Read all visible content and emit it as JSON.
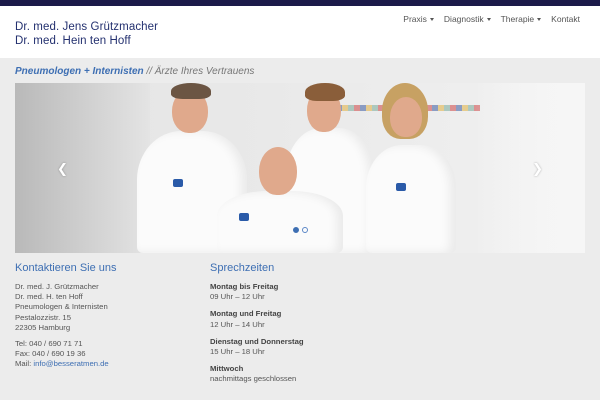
{
  "header": {
    "name1": "Dr. med. Jens Grützmacher",
    "name2": "Dr. med. Hein ten Hoff"
  },
  "nav": [
    {
      "label": "Praxis",
      "dropdown": true
    },
    {
      "label": "Diagnostik",
      "dropdown": true
    },
    {
      "label": "Therapie",
      "dropdown": true
    },
    {
      "label": "Kontakt",
      "dropdown": false
    }
  ],
  "tagline": {
    "accent": "Pneumologen + Internisten",
    "rest": " // Ärzte Ihres Vertrauens"
  },
  "slider": {
    "prev_icon": "chevron-left-icon",
    "next_icon": "chevron-right-icon",
    "slides": 2,
    "active": 1
  },
  "contact": {
    "heading": "Kontaktieren Sie uns",
    "lines": [
      "Dr. med. J. Grützmacher",
      "Dr. med. H. ten Hoff",
      "Pneumologen & Internisten",
      "Pestalozzistr. 15",
      "22305 Hamburg"
    ],
    "tel": "Tel: 040 / 690 71 71",
    "fax": "Fax: 040 / 690 19 36",
    "mail_label": "Mail: ",
    "mail": "info@besseratmen.de"
  },
  "hours": {
    "heading": "Sprechzeiten",
    "blocks": [
      {
        "days": "Montag bis Freitag",
        "time": "09 Uhr – 12 Uhr"
      },
      {
        "days": "Montag und Freitag",
        "time": "12 Uhr – 14 Uhr"
      },
      {
        "days": "Dienstag und Donnerstag",
        "time": "15 Uhr – 18 Uhr"
      },
      {
        "days": "Mittwoch",
        "time": "nachmittags geschlossen"
      }
    ]
  },
  "colors": {
    "topbar": "#1c1a4a",
    "brand": "#23306f",
    "accent": "#3e6fb3",
    "background": "#ececec"
  }
}
